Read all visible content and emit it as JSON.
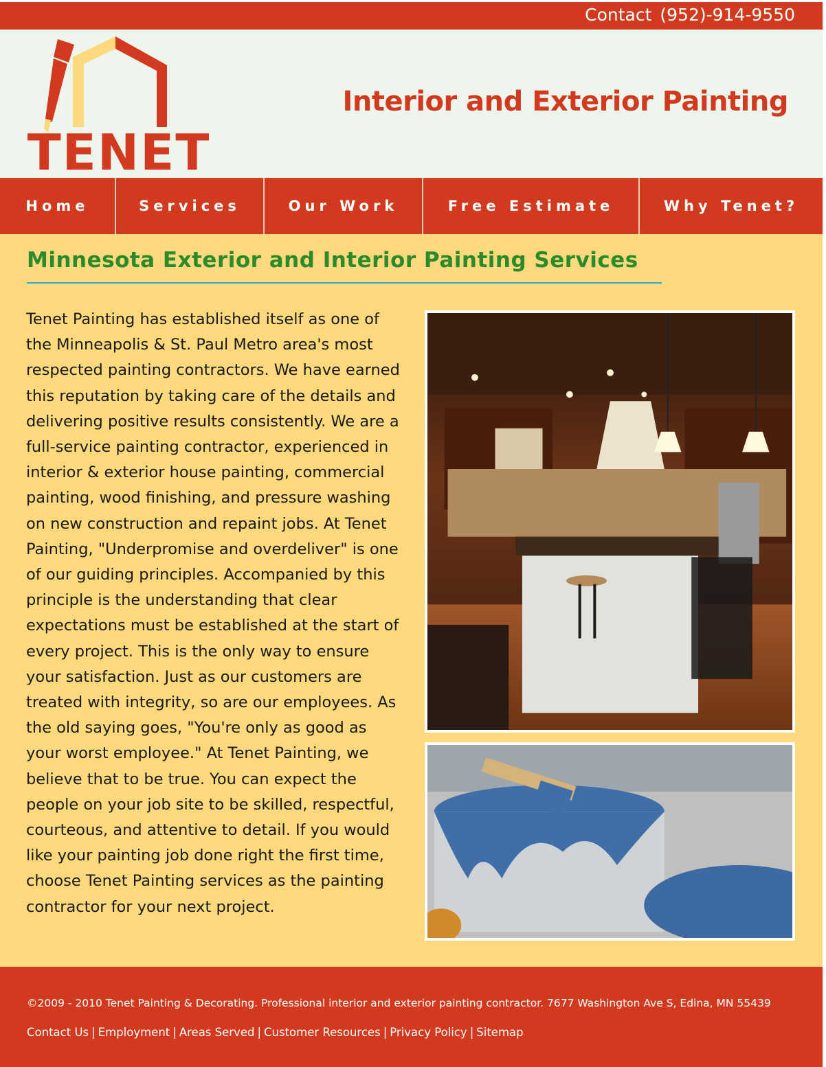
{
  "topbar": {
    "contact_label": "Contact",
    "phone": "(952)-914-9550"
  },
  "header": {
    "logo_text": "TENET",
    "tagline": "Interior and Exterior Painting"
  },
  "nav": {
    "items": [
      {
        "label": "Home"
      },
      {
        "label": "Services"
      },
      {
        "label": "Our Work"
      },
      {
        "label": "Free Estimate"
      },
      {
        "label": "Why Tenet?"
      }
    ]
  },
  "main": {
    "heading": "Minnesota Exterior and Interior Painting Services",
    "body": "Tenet Painting has established itself as one of the Minneapolis & St. Paul Metro area's most respected painting contractors. We have earned this reputation by taking care of the details and delivering positive results consistently. We are a full-service painting contractor, experienced in interior & exterior house painting, commercial painting, wood finishing, and pressure washing on new construction and repaint jobs. At Tenet Painting, \"Underpromise and overdeliver\" is one of our guiding principles. Accompanied by this principle is the understanding that clear expectations must be established at the start of every project. This is the only way to ensure your satisfaction. Just as our customers are treated with integrity, so are our employees. As the old saying goes, \"You're only as good as your worst employee.\" At Tenet Painting, we believe that to be true. You can expect the people on your job site to be skilled, respectful, courteous, and attentive to detail. If you would like your painting job done right the first time, choose Tenet Painting services as the painting contractor for your next project."
  },
  "footer": {
    "copyright": "©2009 - 2010 Tenet Painting & Decorating. Professional interior and exterior painting contractor. 7677 Washington Ave S, Edina, MN 55439",
    "links": [
      {
        "label": "Contact Us"
      },
      {
        "label": "Employment"
      },
      {
        "label": "Areas Served"
      },
      {
        "label": "Customer Resources"
      },
      {
        "label": "Privacy Policy"
      },
      {
        "label": "Sitemap"
      }
    ],
    "separator": "|"
  },
  "colors": {
    "brand_red": "#d13a1f",
    "header_bg": "#eef5ec",
    "content_bg": "#fbd97c",
    "heading_green": "#2b8a2a",
    "rule_blue": "#3aa8c9",
    "logo_yellow": "#fbd97c"
  }
}
